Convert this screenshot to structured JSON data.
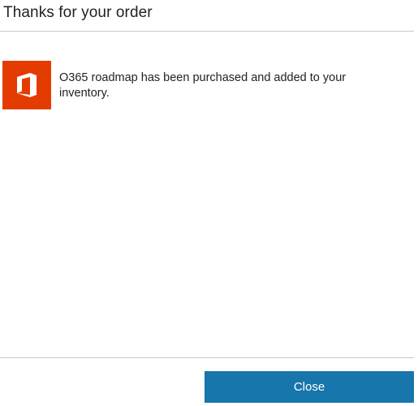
{
  "dialog": {
    "title": "Thanks for your order",
    "message": "O365 roadmap has been purchased and added to your inventory.",
    "close_label": "Close"
  },
  "product": {
    "icon": "office-logo-icon",
    "tile_color": "#e43c00"
  },
  "colors": {
    "accent": "#1776ab",
    "divider": "#c8c8c8"
  }
}
